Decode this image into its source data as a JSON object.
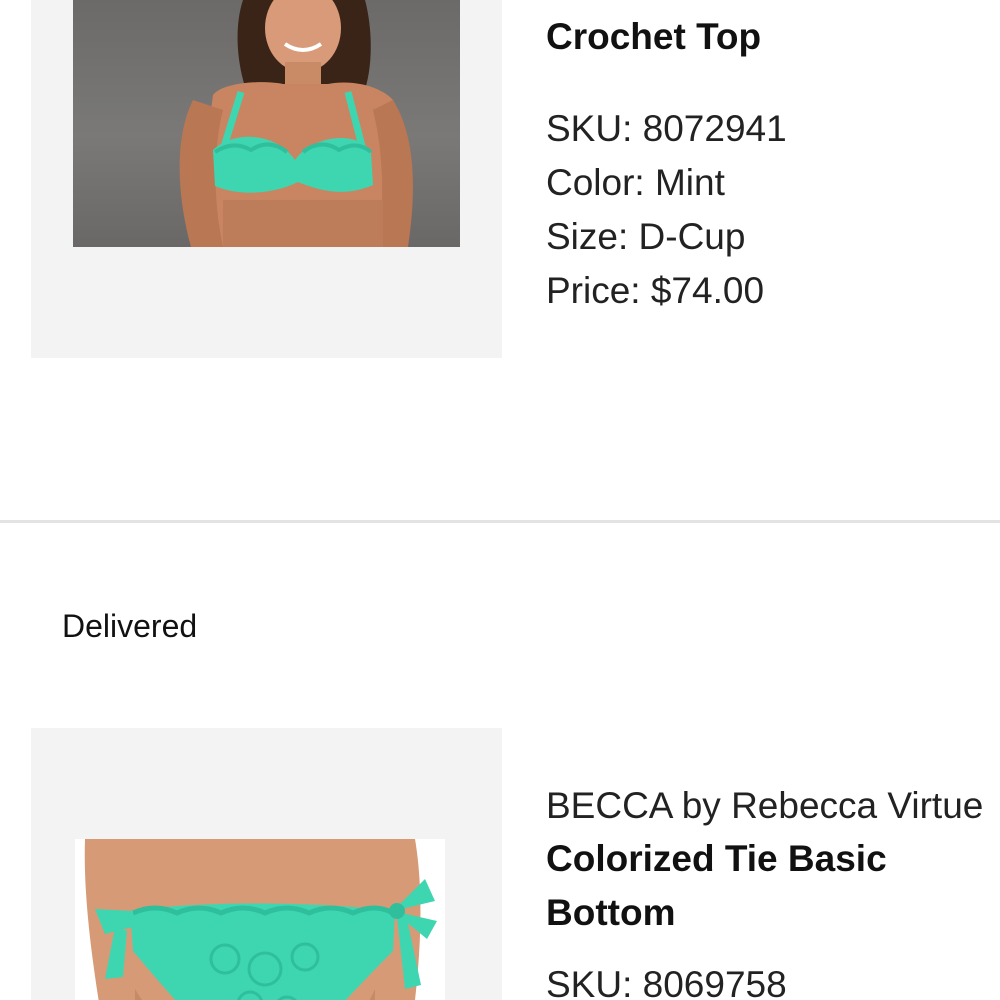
{
  "orders": [
    {
      "title": "Crochet Top",
      "sku": "SKU: 8072941",
      "color": "Color: Mint",
      "size": "Size: D-Cup",
      "price": "Price: $74.00",
      "image_icon": "swimwear-top-photo"
    }
  ],
  "shipment": {
    "status": "Delivered"
  },
  "items": [
    {
      "brand": "BECCA by Rebecca Virtue",
      "title_line1": "Colorized Tie Basic",
      "title_line2": "Bottom",
      "sku_partial": "SKU: 8069758",
      "image_icon": "swimwear-bottom-photo"
    }
  ],
  "colors": {
    "mint": "#3ed6b1",
    "panel": "#f3f3f3",
    "divider": "#e3e3e3"
  }
}
